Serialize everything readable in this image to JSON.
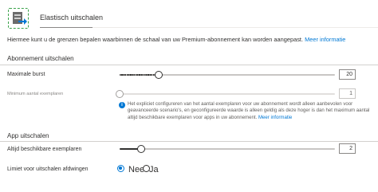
{
  "tab": {
    "title": "Elastisch uitschalen",
    "icon": "app-service-scale-out-icon"
  },
  "description": {
    "text": "Hiermee kunt u de grenzen bepalen waarbinnen de schaal van uw Premium-abonnement kan worden aangepast.",
    "link": "Meer informatie"
  },
  "plan_scale": {
    "header": "Abonnement uitschalen",
    "max_burst": {
      "label": "Maximale burst",
      "value": "20",
      "fraction": 0.18
    },
    "min_instances": {
      "label": "Minimum aantal exemplaren",
      "value": "1",
      "fraction": 0.0
    },
    "info": {
      "text": "Het expliciet configureren van het aantal exemplaren voor uw abonnement wordt alleen aanbevolen voor geavanceerde scenario's, en geconfigureerde waarde is alleen geldig als deze hoger is dan het maximum aantal altijd beschikbare exemplaren voor apps in uw abonnement.",
      "link": "Meer informatie"
    }
  },
  "app_scale": {
    "header": "App uitschalen",
    "always_ready": {
      "label": "Altijd beschikbare exemplaren",
      "value": "2",
      "fraction": 0.1
    },
    "limit": {
      "label": "Limiet voor uitschalen afdwingen",
      "options": [
        {
          "label": "Nee",
          "checked": true
        },
        {
          "label": "Ja",
          "checked": false
        }
      ]
    }
  },
  "colors": {
    "accent": "#0078d4",
    "icon_border": "#3aa24a",
    "track": "#c8c6c4",
    "text": "#323130"
  }
}
